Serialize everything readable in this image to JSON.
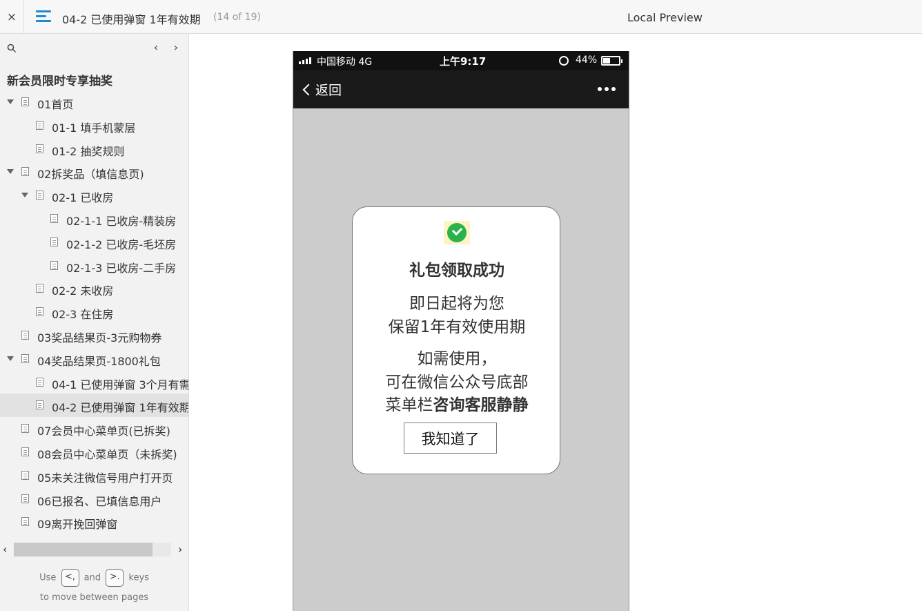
{
  "topbar": {
    "close_label": "×",
    "page_title": "04-2 已使用弹窗 1年有效期",
    "page_count": "(14 of 19)",
    "preview_label": "Local Preview"
  },
  "sidebar": {
    "prev_label": "‹",
    "next_label": "›",
    "project_title": "新会员限时专享抽奖",
    "items": [
      {
        "label": "01首页",
        "level": 1,
        "expanded": true
      },
      {
        "label": "01-1 填手机蒙层",
        "level": 2
      },
      {
        "label": "01-2 抽奖规则",
        "level": 2
      },
      {
        "label": "02拆奖品（填信息页)",
        "level": 1,
        "expanded": true
      },
      {
        "label": "02-1 已收房",
        "level": 2,
        "expanded": true
      },
      {
        "label": "02-1-1 已收房-精装房",
        "level": 3
      },
      {
        "label": "02-1-2 已收房-毛坯房",
        "level": 3
      },
      {
        "label": "02-1-3 已收房-二手房",
        "level": 3
      },
      {
        "label": "02-2 未收房",
        "level": 2
      },
      {
        "label": "02-3 在住房",
        "level": 2
      },
      {
        "label": "03奖品结果页-3元购物券",
        "level": 1
      },
      {
        "label": "04奖品结果页-1800礼包",
        "level": 1,
        "expanded": true
      },
      {
        "label": "04-1 已使用弹窗 3个月有需",
        "level": 2
      },
      {
        "label": "04-2 已使用弹窗 1年有效期",
        "level": 2,
        "selected": true
      },
      {
        "label": "07会员中心菜单页(已拆奖)",
        "level": 1
      },
      {
        "label": "08会员中心菜单页（未拆奖)",
        "level": 1
      },
      {
        "label": "05未关注微信号用户打开页",
        "level": 1
      },
      {
        "label": "06已报名、已填信息用户",
        "level": 1
      },
      {
        "label": "09离开挽回弹窗",
        "level": 1
      }
    ],
    "hscroll": {
      "left_label": "‹",
      "right_label": "›",
      "thumb_fraction": 0.88
    },
    "hint": {
      "use": "Use",
      "key_prev": "<,",
      "and": "and",
      "key_next": ">.",
      "keys": "keys",
      "line2": "to move between pages"
    }
  },
  "phone": {
    "status": {
      "carrier": "中国移动   4G",
      "time": "上午9:17",
      "battery": "44%",
      "battery_level": 0.44
    },
    "nav": {
      "back_label": "返回"
    },
    "dialog": {
      "title": "礼包领取成功",
      "line1": "即日起将为您",
      "line2": "保留1年有效使用期",
      "line3": "如需使用，",
      "line4": "可在微信公众号底部",
      "line5_prefix": "菜单栏",
      "line5_bold": "咨询客服静静",
      "button_label": "我知道了"
    }
  }
}
